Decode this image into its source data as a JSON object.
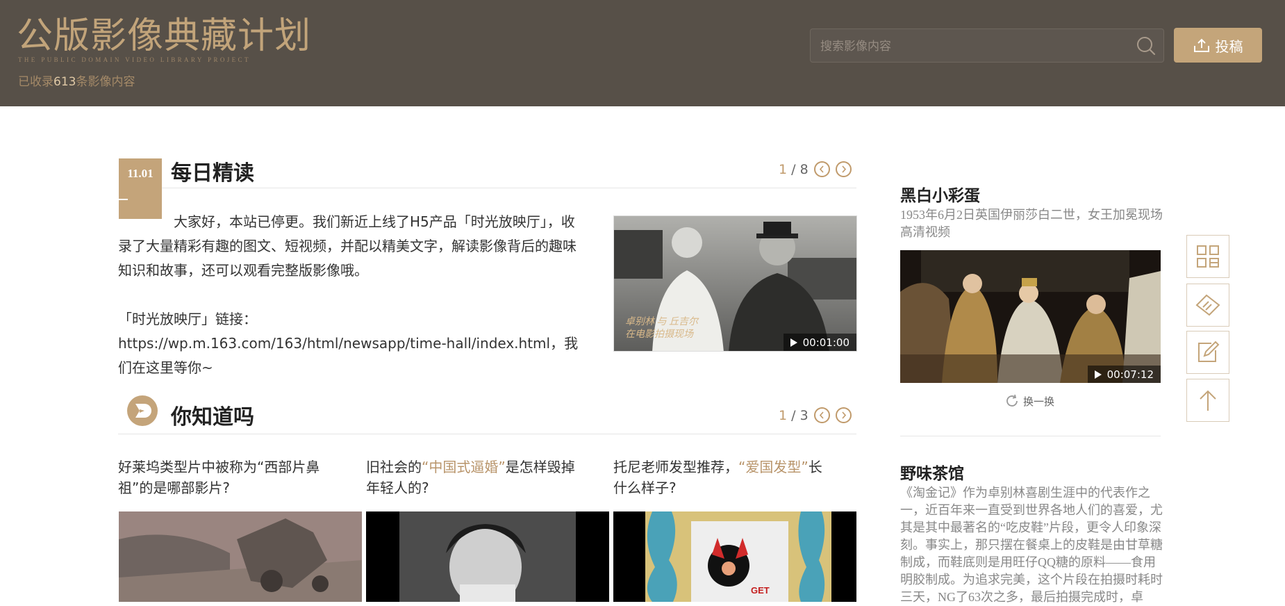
{
  "header": {
    "logo_title": "公版影像典藏计划",
    "logo_subtitle": "THE PUBLIC DOMAIN VIDEO LIBRARY PROJECT",
    "count_prefix": "已收录",
    "count_value": "613",
    "count_suffix": "条影像内容",
    "search_placeholder": "搜索影像内容",
    "upload_label": "投稿"
  },
  "daily": {
    "date": "11.01",
    "title": "每日精读",
    "page_current": "1",
    "page_total": "/ 8",
    "para1": "大家好，本站已停更。我们新近上线了H5产品「时光放映厅」，收录了大量精彩有趣的图文、短视频，并配以精美文字，解读影像背后的趣味知识和故事，还可以观看完整版影像哦。",
    "para2": "「时光放映厅」链接：https://wp.m.163.com/163/html/newsapp/time-hall/index.html，我们在这里等你~",
    "video_caption": "卓别林 与 丘吉尔\n在电影拍摄现场",
    "video_duration": "00:01:00"
  },
  "dyk": {
    "title": "你知道吗",
    "page_current": "1",
    "page_total": "/ 3",
    "items": [
      {
        "pre": "好莱坞类型片中被称为“西部片鼻祖”的是哪部影片?",
        "hl": "",
        "post": ""
      },
      {
        "pre": "旧社会的",
        "hl": "“中国式逼婚”",
        "post": "是怎样毁掉年轻人的?"
      },
      {
        "pre": "托尼老师发型推荐，",
        "hl": "“爱国发型”",
        "post": "长什么样子?"
      }
    ],
    "thumb3_text": "GET"
  },
  "side": {
    "easter_title": "黑白小彩蛋",
    "easter_desc": "1953年6月2日英国伊丽莎白二世，女王加冕现场高清视频",
    "easter_duration": "00:07:12",
    "refresh_label": "换一换",
    "teahouse_title": "野味茶馆",
    "teahouse_desc": "《淘金记》作为卓别林喜剧生涯中的代表作之一，近百年来一直受到世界各地人们的喜爱，尤其是其中最著名的“吃皮鞋”片段，更令人印象深刻。事实上，那只摆在餐桌上的皮鞋是由甘草糖制成，而鞋底则是用旺仔QQ糖的原料——食用明胶制成。为追求完美，这个片段在拍摄时耗时三天，NG了63次之多，最后拍摄完成时，卓"
  },
  "colors": {
    "header_bg": "#575048",
    "accent": "#c4a57a",
    "highlight_text": "#b8946a"
  }
}
